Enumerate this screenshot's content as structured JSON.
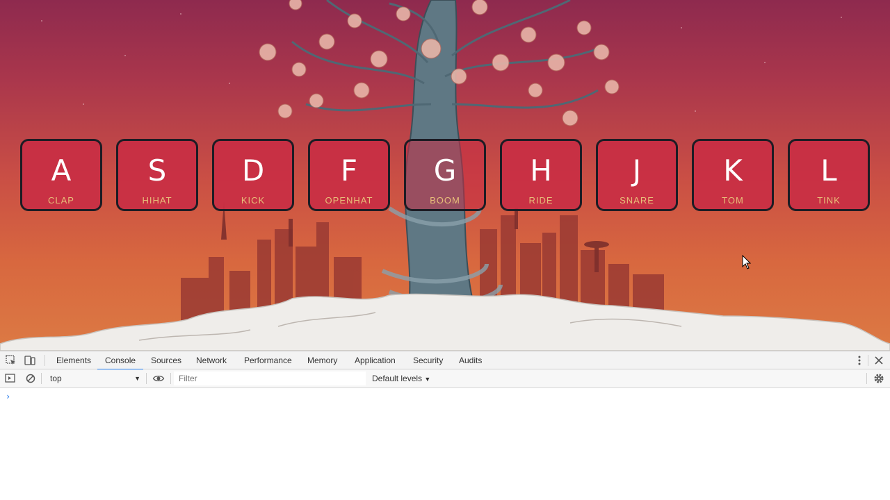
{
  "drum_kit": {
    "keys": [
      {
        "key": "A",
        "sound": "CLAP"
      },
      {
        "key": "S",
        "sound": "HIHAT"
      },
      {
        "key": "D",
        "sound": "KICK"
      },
      {
        "key": "F",
        "sound": "OPENHAT"
      },
      {
        "key": "G",
        "sound": "BOOM"
      },
      {
        "key": "H",
        "sound": "RIDE"
      },
      {
        "key": "J",
        "sound": "SNARE"
      },
      {
        "key": "K",
        "sound": "TOM"
      },
      {
        "key": "L",
        "sound": "TINK"
      }
    ]
  },
  "devtools": {
    "tabs": [
      "Elements",
      "Console",
      "Sources",
      "Network",
      "Performance",
      "Memory",
      "Application",
      "Security",
      "Audits"
    ],
    "active_tab": "Console",
    "context": "top",
    "filter_placeholder": "Filter",
    "levels_label": "Default levels",
    "prompt_symbol": "›",
    "icons": [
      "inspect-icon",
      "device-toolbar-icon",
      "more-icon",
      "close-icon",
      "sidebar-icon",
      "clear-console-icon",
      "eye-icon",
      "settings-icon"
    ]
  },
  "colors": {
    "accent": "#1a73e8",
    "key_bg": "#c82c44",
    "key_border": "#1c1c24",
    "sound_label": "#e8c07a"
  }
}
